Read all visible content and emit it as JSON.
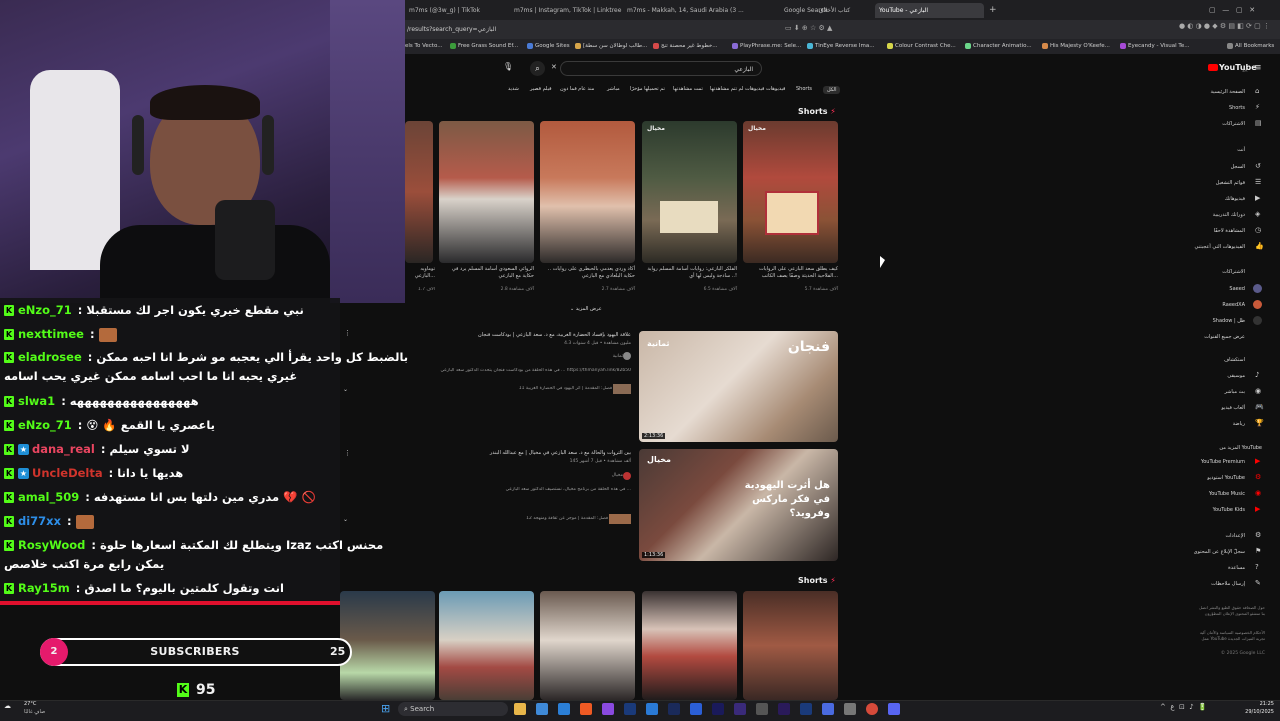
{
  "browser": {
    "tabs": [
      {
        "label": "m7ms (@3w_g) | TikTok"
      },
      {
        "label": "m7ms | Instagram, TikTok | Linktree"
      },
      {
        "label": "m7ms - Makkah, 14, Saudi Arabia (3 ..."
      },
      {
        "label": "Google Search"
      },
      {
        "label": "YouTube - البازعي"
      }
    ],
    "extra_tab": "كتاب الأخلاق",
    "url": "/results?search_query=البازعي",
    "bookmarks": [
      {
        "label": "els To Vecto..."
      },
      {
        "label": "Free Grass Sound Ef..."
      },
      {
        "label": "Google Sites"
      },
      {
        "label": "[طالب لوطالان سن سطة..."
      },
      {
        "label": "خطوط غير محصنة تنج..."
      },
      {
        "label": "PlayPhrase.me: Sele..."
      },
      {
        "label": "TinEye Reverse Ima..."
      },
      {
        "label": "Colour Contrast Che..."
      },
      {
        "label": "Character Animatio..."
      },
      {
        "label": "His Majesty O'Keefe..."
      },
      {
        "label": "Eyecandy - Visual Te..."
      },
      {
        "label": "All Bookmarks"
      }
    ]
  },
  "youtube": {
    "logo": "YouTube",
    "country": "SA",
    "search_value": "البازعي",
    "chips": [
      "الكل",
      "Shorts",
      "فيديوهات",
      "فيديوهات لم تتم مشاهدتها",
      "تمت مشاهدتها",
      "تم تحميلها مؤخرًا",
      "مباشر",
      "منذ عام فما دون",
      "فيلم قصير",
      "الموسيقى",
      "شديد"
    ],
    "section_shorts": "Shorts",
    "shorts": [
      {
        "title": "كيف يطلق سعد البازعي على الروايات الفلاحية الحديثة وصفًا يصف الكاتب...",
        "views": "5.7 آلاف مشاهدة"
      },
      {
        "title": "الفلكر البازعي: روايات أسامة المسلم رواية ساذجة وليس لها أي ..!",
        "views": "6.5 آلاف مشاهدة"
      },
      {
        "title": "أكاد وردي يعدمي بالحبطري على روايات .. حكاية البلعادي مع البازعي",
        "views": "2.7 آلاف مشاهدة"
      },
      {
        "title": "الروائي السعودي أسامة المسلم يرد في حكاية مع البازعي",
        "views": "2.8 آلاف مشاهدة"
      },
      {
        "title": "توماويه البازعي...",
        "views": "1.7 آلاف"
      }
    ],
    "show_more": "عرض المزيد",
    "videos": [
      {
        "title": "علاقة اليهود بإفساد الحضارة الغربية، مع د. سعد البازعي | بودكاست فنجان",
        "meta": "4.3 مليون مشاهدة • قبل 4 سنوات",
        "channel": "ثمانية",
        "desc": "في هذه الحلقة من بودكاست فنجان يتحدث الدكتور سعد البازعي ... https://thmanyah.link/82b50",
        "chapters": "11 فصل: المقدمة | أثر اليهود في الحضارة الغربية",
        "duration": "2:13:36",
        "thumb_text": "فنجان"
      },
      {
        "title": "بين الثروات والحالة مع د. سعد البازعي في مخيال | مع عبدالله البندر",
        "meta": "145 ألف مشاهدة • قبل 7 أشهر",
        "channel": "مخيال",
        "desc": "في هذه الحلقة من برنامج مخيال، نستضيف الدكتور سعد البازعي ...",
        "chapters": "12 فصل: المقدمة | موجز عن ثقافة ومنهجه",
        "duration": "1:13:36",
        "thumb_text": "هل أثرت اليهودية في فكر ماركس وفرويد؟"
      }
    ],
    "section_shorts_2": "Shorts",
    "sidebar": [
      {
        "label": "الصفحة الرئيسية"
      },
      {
        "label": "Shorts"
      },
      {
        "label": "الاشتراكات"
      },
      {
        "label": "أنت"
      },
      {
        "label": "السجل"
      },
      {
        "label": "قوائم التشغيل"
      },
      {
        "label": "فيديوهاتك"
      },
      {
        "label": "دوراتك التدريبية"
      },
      {
        "label": "المشاهدة لاحقًا"
      },
      {
        "label": "الفيديوهات التي أعجبتني"
      },
      {
        "label": "الاشتراكات"
      },
      {
        "label": "Saeed"
      },
      {
        "label": "RaeedXA"
      },
      {
        "label": "Shadow | ظل"
      },
      {
        "label": "عرض جميع القنوات"
      },
      {
        "label": "استكشاف"
      },
      {
        "label": "موسيقى"
      },
      {
        "label": "بث مباشر"
      },
      {
        "label": "ألعاب فيديو"
      },
      {
        "label": "رياضة"
      },
      {
        "label": "المزيد من YouTube"
      },
      {
        "label": "YouTube Premium"
      },
      {
        "label": "استوديو YouTube"
      },
      {
        "label": "YouTube Music"
      },
      {
        "label": "YouTube Kids"
      },
      {
        "label": "الإعدادات"
      },
      {
        "label": "سجلّ الإبلاغ عن المحتوى"
      },
      {
        "label": "مساعدة"
      },
      {
        "label": "إرسال ملاحظات"
      }
    ],
    "footer_links": "حول الصحافة حقوق الطبع والنشر اتصل بنا منشئو المحتوى الإعلان المطوّرون",
    "footer_links_2": "الأحكام الخصوصية السياسة والأمان آلية عمل YouTube تجربة الميزات الجديدة",
    "copyright": "© 2025 Google LLC"
  },
  "chat": [
    {
      "user": "eNzo_71",
      "color": "#53fc18",
      "badge": "",
      "msg": "نبي مقطع خيري يكون اجر لك مستقبلا"
    },
    {
      "user": "nexttimee",
      "color": "#53fc18",
      "badge": "",
      "msg": "",
      "emote": true
    },
    {
      "user": "eladrosee",
      "color": "#53fc18",
      "badge": "",
      "msg": "بالضبط كل واحد يقرأ الي يعجبه مو شرط انا احبه ممكن"
    },
    {
      "user": "",
      "color": "#ffffff",
      "badge": "",
      "msg": "غيري يحبه انا ما احب اسامه ممكن غيري يحب اسامه"
    },
    {
      "user": "slwa1",
      "color": "#53fc18",
      "badge": "",
      "msg": "ههههههههههههههههه"
    },
    {
      "user": "eNzo_71",
      "color": "#53fc18",
      "badge": "",
      "msg": "😵 🔥 ياعصري يا القمع"
    },
    {
      "user": "dana_real",
      "color": "#e94560",
      "badge": "sub",
      "msg": "لا تسوي سيلم"
    },
    {
      "user": "UncleDelta",
      "color": "#c0392b",
      "badge": "sub",
      "msg": "هديها يا دانا"
    },
    {
      "user": "amal_509",
      "color": "#53fc18",
      "badge": "",
      "msg": "مدري مين دلتها بس انا مستهدفه 💔 🚫"
    },
    {
      "user": "di77xx",
      "color": "#2d8ee8",
      "badge": "",
      "msg": "",
      "emote": true
    },
    {
      "user": "RosyWood",
      "color": "#53fc18",
      "badge": "",
      "msg": "ويتطلع لك المكتبة اسعارها حلوة Izaz محنس اكتب"
    },
    {
      "user": "",
      "color": "#ffffff",
      "badge": "",
      "msg": "يمكن رابع مرة اكتب خلاصص"
    },
    {
      "user": "Ray15m",
      "color": "#53fc18",
      "badge": "",
      "msg": "انت وتقول كلمتين باليوم؟ ما اصدق"
    }
  ],
  "overlay": {
    "sub_current": "2",
    "sub_label": "SUBSCRIBERS",
    "sub_goal": "25",
    "viewers": "95"
  },
  "taskbar": {
    "weather_temp": "27°C",
    "weather_desc": "صافٍ غالبًا",
    "search_label": "Search",
    "time": "21:25",
    "date": "29/10/2025"
  }
}
